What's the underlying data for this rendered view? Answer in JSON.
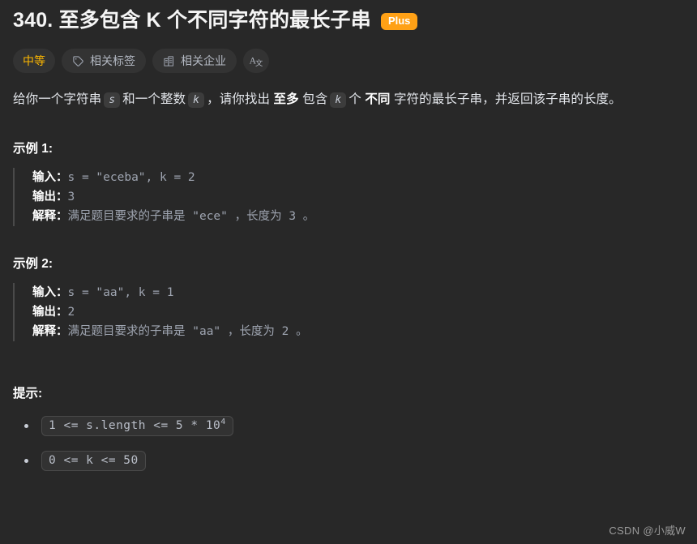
{
  "problem": {
    "title": "340. 至多包含 K 个不同字符的最长子串",
    "plus_badge": "Plus",
    "difficulty": "中等",
    "tags_button": "相关标签",
    "companies_button": "相关企业",
    "description": {
      "part1": "给你一个字符串",
      "code_s": "s",
      "part2": "和一个整数",
      "code_k": "k",
      "part3": "，请你找出",
      "bold1": "至多",
      "part4": "包含",
      "code_k2": "k",
      "part5": "个",
      "bold2": "不同",
      "part6": "字符的最长子串，并返回该子串的长度。"
    }
  },
  "examples": [
    {
      "heading": "示例 1:",
      "input_label": "输入：",
      "input_value": "s = \"eceba\", k = 2",
      "output_label": "输出：",
      "output_value": "3",
      "explain_label": "解释：",
      "explain_value": "满足题目要求的子串是 \"ece\" ，长度为 3 。"
    },
    {
      "heading": "示例 2:",
      "input_label": "输入：",
      "input_value": "s = \"aa\", k = 1",
      "output_label": "输出：",
      "output_value": "2",
      "explain_label": "解释：",
      "explain_value": "满足题目要求的子串是 \"aa\" ，长度为 2 。"
    }
  ],
  "hints": {
    "heading": "提示:",
    "items": [
      {
        "prefix": "1 <= s.length <= 5 * 10",
        "sup": "4"
      },
      {
        "prefix": "0 <= k <= 50",
        "sup": ""
      }
    ]
  },
  "watermark": "CSDN @小威W",
  "colors": {
    "background": "#282828",
    "accent_orange": "#ffa116",
    "difficulty_orange": "#ffb800",
    "text_primary": "#eff1f6",
    "text_muted": "#9ea4b0"
  }
}
